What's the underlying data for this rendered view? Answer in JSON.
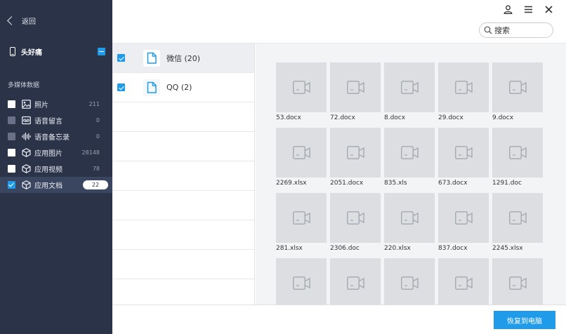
{
  "sidebar": {
    "back_label": "返回",
    "device_name": "头好痛",
    "section_label": "多媒体数据",
    "categories": [
      {
        "label": "照片",
        "count": "211",
        "icon": "photo-icon",
        "checkbox": "white"
      },
      {
        "label": "语音留言",
        "count": "0",
        "icon": "voicemail-icon",
        "checkbox": "gray"
      },
      {
        "label": "语音备忘录",
        "count": "0",
        "icon": "audio-wave-icon",
        "checkbox": "gray"
      },
      {
        "label": "应用图片",
        "count": "28148",
        "icon": "app-cube-icon",
        "checkbox": "white"
      },
      {
        "label": "应用视频",
        "count": "78",
        "icon": "app-cube-icon",
        "checkbox": "white"
      },
      {
        "label": "应用文档",
        "count": "22",
        "icon": "app-cube-icon",
        "checkbox": "checked"
      }
    ]
  },
  "search": {
    "placeholder": "搜索"
  },
  "accounts": [
    {
      "label": "微信 (20)",
      "checked": true
    },
    {
      "label": "QQ (2)",
      "checked": true
    }
  ],
  "files": [
    "53.docx",
    "72.docx",
    "8.docx",
    "29.docx",
    "9.docx",
    "2269.xlsx",
    "2051.docx",
    "835.xls",
    "673.docx",
    "1291.doc",
    "281.xlsx",
    "2306.doc",
    "220.xlsx",
    "837.docx",
    "2245.xlsx",
    "",
    "",
    "",
    "",
    ""
  ],
  "restore_button": "恢复到电脑",
  "colors": {
    "sidebar_bg": "#2b3348",
    "accent": "#1f9bea",
    "thumb_bg": "#dcdee2"
  }
}
